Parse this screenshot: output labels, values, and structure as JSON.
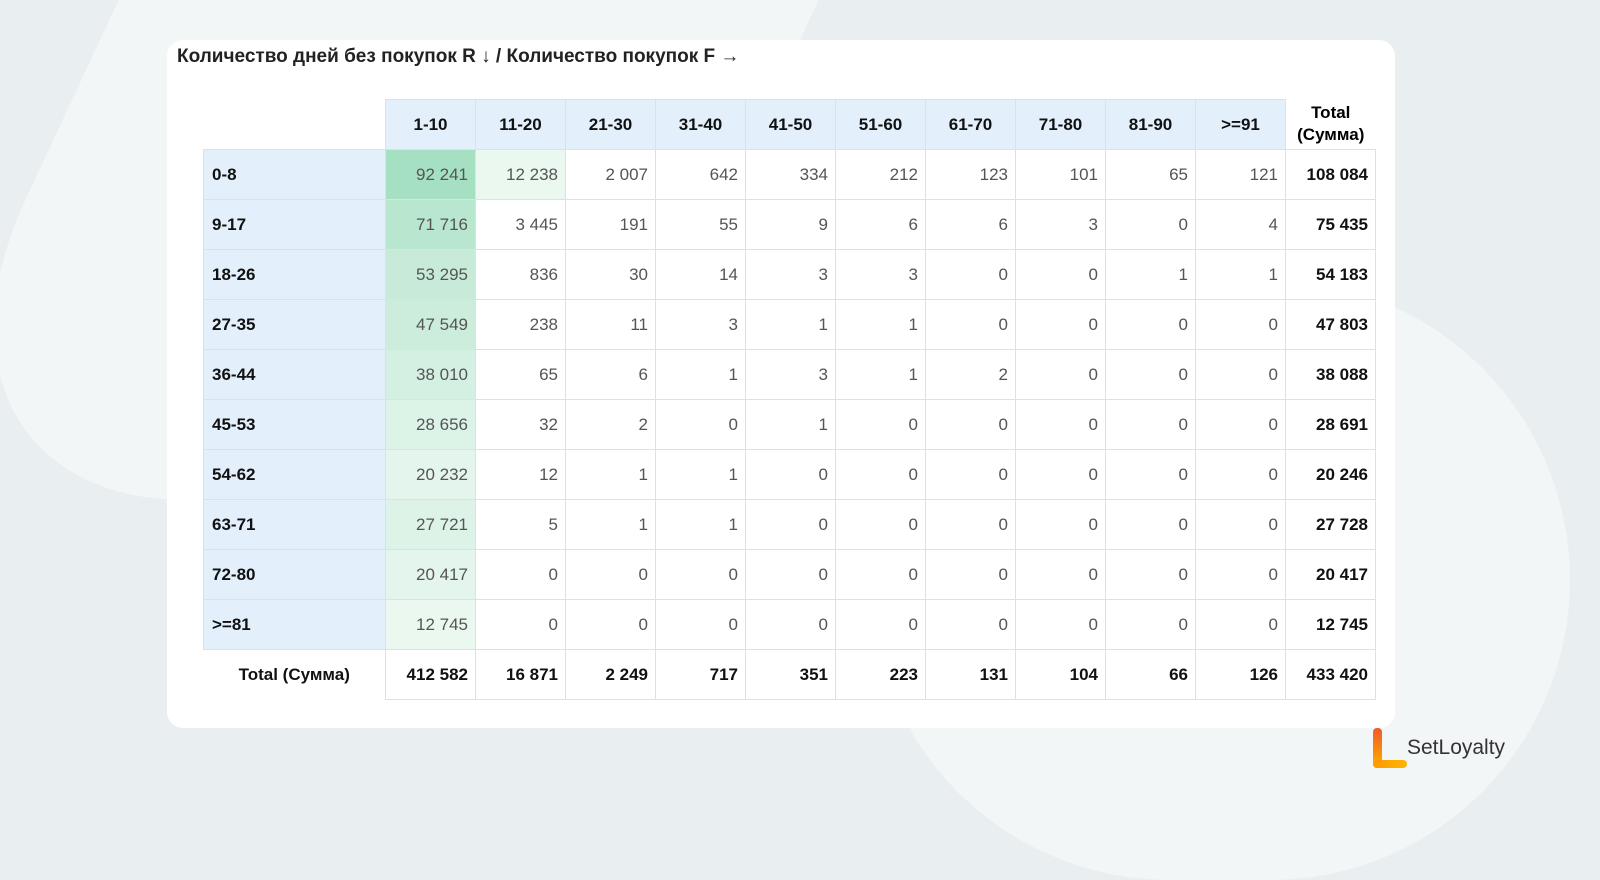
{
  "title": "Количество дней без покупок R ↓ / Количество покупок F →",
  "columns": [
    "1-10",
    "11-20",
    "21-30",
    "31-40",
    "41-50",
    "51-60",
    "61-70",
    "71-80",
    "81-90",
    ">=91"
  ],
  "total_header": [
    "Total",
    "(Сумма)"
  ],
  "rows": [
    {
      "label": "0-8",
      "values": [
        "92 241",
        "12 238",
        "2 007",
        "642",
        "334",
        "212",
        "123",
        "101",
        "65",
        "121"
      ],
      "raw": [
        92241,
        12238,
        2007,
        642,
        334,
        212,
        123,
        101,
        65,
        121
      ],
      "total": "108 084"
    },
    {
      "label": "9-17",
      "values": [
        "71 716",
        "3 445",
        "191",
        "55",
        "9",
        "6",
        "6",
        "3",
        "0",
        "4"
      ],
      "raw": [
        71716,
        3445,
        191,
        55,
        9,
        6,
        6,
        3,
        0,
        4
      ],
      "total": "75 435"
    },
    {
      "label": "18-26",
      "values": [
        "53 295",
        "836",
        "30",
        "14",
        "3",
        "3",
        "0",
        "0",
        "1",
        "1"
      ],
      "raw": [
        53295,
        836,
        30,
        14,
        3,
        3,
        0,
        0,
        1,
        1
      ],
      "total": "54 183"
    },
    {
      "label": "27-35",
      "values": [
        "47 549",
        "238",
        "11",
        "3",
        "1",
        "1",
        "0",
        "0",
        "0",
        "0"
      ],
      "raw": [
        47549,
        238,
        11,
        3,
        1,
        1,
        0,
        0,
        0,
        0
      ],
      "total": "47 803"
    },
    {
      "label": "36-44",
      "values": [
        "38 010",
        "65",
        "6",
        "1",
        "3",
        "1",
        "2",
        "0",
        "0",
        "0"
      ],
      "raw": [
        38010,
        65,
        6,
        1,
        3,
        1,
        2,
        0,
        0,
        0
      ],
      "total": "38 088"
    },
    {
      "label": "45-53",
      "values": [
        "28 656",
        "32",
        "2",
        "0",
        "1",
        "0",
        "0",
        "0",
        "0",
        "0"
      ],
      "raw": [
        28656,
        32,
        2,
        0,
        1,
        0,
        0,
        0,
        0,
        0
      ],
      "total": "28 691"
    },
    {
      "label": "54-62",
      "values": [
        "20 232",
        "12",
        "1",
        "1",
        "0",
        "0",
        "0",
        "0",
        "0",
        "0"
      ],
      "raw": [
        20232,
        12,
        1,
        1,
        0,
        0,
        0,
        0,
        0,
        0
      ],
      "total": "20 246"
    },
    {
      "label": "63-71",
      "values": [
        "27 721",
        "5",
        "1",
        "1",
        "0",
        "0",
        "0",
        "0",
        "0",
        "0"
      ],
      "raw": [
        27721,
        5,
        1,
        1,
        0,
        0,
        0,
        0,
        0,
        0
      ],
      "total": "27 728"
    },
    {
      "label": "72-80",
      "values": [
        "20 417",
        "0",
        "0",
        "0",
        "0",
        "0",
        "0",
        "0",
        "0",
        "0"
      ],
      "raw": [
        20417,
        0,
        0,
        0,
        0,
        0,
        0,
        0,
        0,
        0
      ],
      "total": "20 417"
    },
    {
      "label": ">=81",
      "values": [
        "12 745",
        "0",
        "0",
        "0",
        "0",
        "0",
        "0",
        "0",
        "0",
        "0"
      ],
      "raw": [
        12745,
        0,
        0,
        0,
        0,
        0,
        0,
        0,
        0,
        0
      ],
      "total": "12 745"
    }
  ],
  "footer": {
    "label": "Total (Сумма)",
    "values": [
      "412 582",
      "16 871",
      "2 249",
      "717",
      "351",
      "223",
      "131",
      "104",
      "66",
      "126"
    ],
    "total": "433 420"
  },
  "heat_color": "#a6e0c2",
  "brand": "SetLoyalty"
}
